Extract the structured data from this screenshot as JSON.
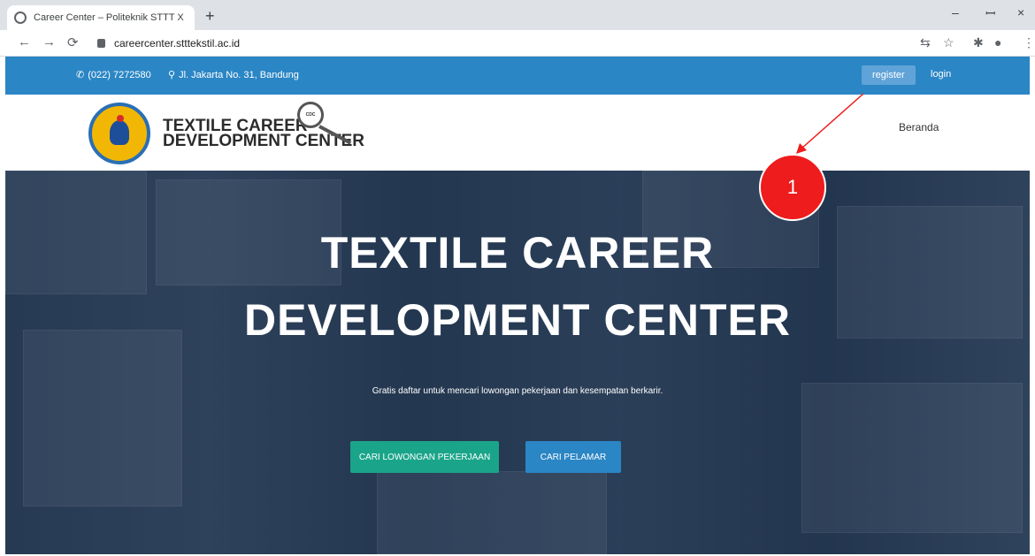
{
  "browser": {
    "tab_title": "Career Center – Politeknik STTT  X",
    "tab_close": "×",
    "new_tab": "+",
    "url": "careercenter.stttekstil.ac.id",
    "minimize": "–",
    "restore": "ꟷ",
    "close": "×"
  },
  "topbar": {
    "phone": "(022) 7272580",
    "address": "Jl. Jakarta No. 31, Bandung",
    "register_label": "register",
    "login_label": "login",
    "bg_color": "#2b86c5"
  },
  "header": {
    "brand_line1": "TEXTILE CAREER",
    "brand_line2": "DEVELOPMENT CENTER",
    "badge_text": "CDC",
    "nav_beranda": "Beranda"
  },
  "hero": {
    "title_line1": "TEXTILE CAREER",
    "title_line2": "DEVELOPMENT CENTER",
    "subtitle": "Gratis daftar untuk mencari lowongan pekerjaan dan kesempatan berkarir.",
    "btn_jobs": "CARI LOWONGAN PEKERJAAN",
    "btn_pelamar": "CARI PELAMAR",
    "btn_jobs_color": "#1aa58a",
    "btn_pelamar_color": "#2b86c5"
  },
  "annotation": {
    "number": "1",
    "color": "#ee1c1c"
  }
}
